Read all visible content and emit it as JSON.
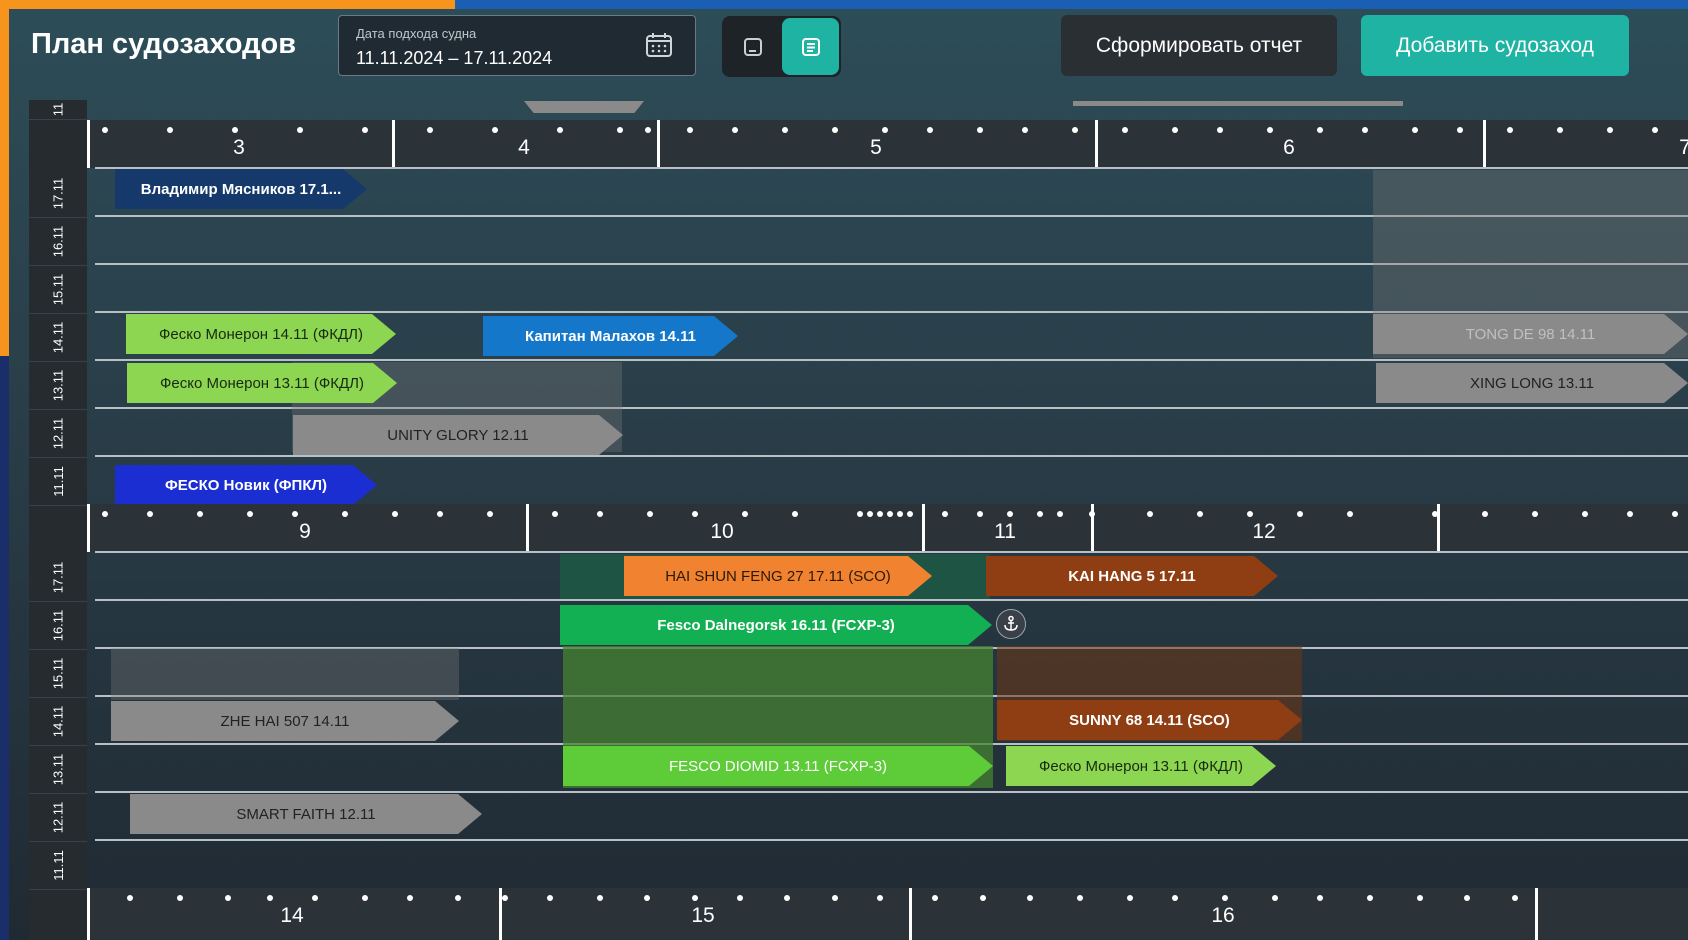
{
  "header": {
    "title": "План судозаходов",
    "date_filter": {
      "label": "Дата подхода судна",
      "value": "11.11.2024 – 17.11.2024"
    },
    "report_button": "Сформировать отчет",
    "add_button": "Добавить судозаход"
  },
  "colors": {
    "accent": "#f7941d",
    "primary": "#1fb3a3"
  },
  "days": [
    "17.11",
    "16.11",
    "15.11",
    "14.11",
    "13.11",
    "12.11",
    "11.11"
  ],
  "top_rail_label": "11",
  "sections": [
    {
      "hours": [
        "3",
        "4",
        "5",
        "6",
        "7"
      ],
      "vessels": [
        {
          "name": "Владимир Мясников  17.1...",
          "color": "#14396a"
        },
        {
          "name": "Феско Монерон  14.11 (ФКДЛ)",
          "color": "#8cd651"
        },
        {
          "name": "Капитан Малахов  14.11",
          "color": "#1477c9"
        },
        {
          "name": "TONG DE 98  14.11",
          "color": "#8a8a8a"
        },
        {
          "name": "Феско Монерон  13.11 (ФКДЛ)",
          "color": "#8cd651"
        },
        {
          "name": "XING LONG  13.11",
          "color": "#8a8a8a"
        },
        {
          "name": "UNITY GLORY  12.11",
          "color": "#8a8a8a"
        },
        {
          "name": "ФЕСКО Новик (ФПКЛ)",
          "color": "#1b2ed2"
        }
      ]
    },
    {
      "hours": [
        "9",
        "10",
        "11",
        "12"
      ],
      "vessels": [
        {
          "name": "HAI SHUN FENG 27  17.11 (SCO)",
          "color": "#f08230"
        },
        {
          "name": "KAI HANG 5  17.11",
          "color": "#8e3e12"
        },
        {
          "name": "Fesco Dalnegorsk  16.11 (FCXP-3)",
          "color": "#12b052"
        },
        {
          "name": "ZHE HAI 507  14.11",
          "color": "#8a8a8a"
        },
        {
          "name": "SUNNY 68  14.11 (SCO)",
          "color": "#8e3e12"
        },
        {
          "name": "FESCO DIOMID  13.11 (FCXP-3)",
          "color": "#5ecb38"
        },
        {
          "name": "Феско Монерон  13.11 (ФКДЛ)",
          "color": "#8cd651"
        },
        {
          "name": "SMART FAITH  12.11",
          "color": "#8a8a8a"
        }
      ]
    },
    {
      "hours": [
        "14",
        "15",
        "16"
      ]
    }
  ]
}
